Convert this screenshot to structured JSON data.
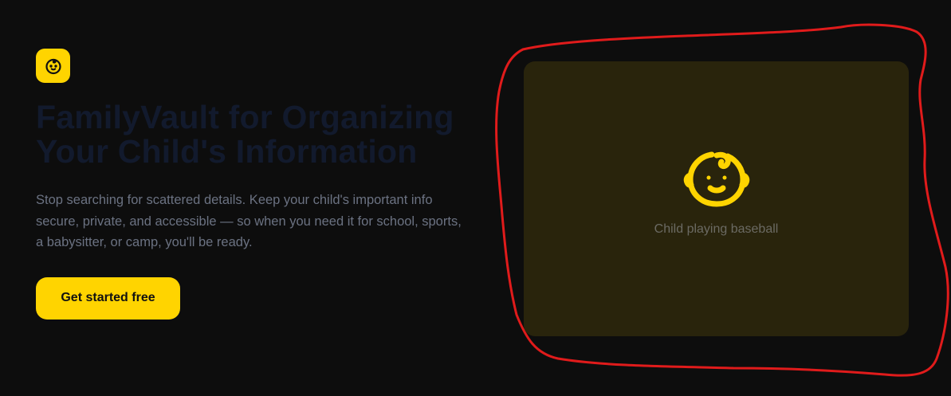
{
  "brand": {
    "icon": "baby-face-icon",
    "accent_color": "#ffd400"
  },
  "hero": {
    "title": "FamilyVault for Organizing Your Child's Information",
    "subtitle": "Stop searching for scattered details. Keep your child's important info secure, private, and accessible — so when you need it for school, sports, a babysitter, or camp, you'll be ready.",
    "cta_label": "Get started free"
  },
  "media": {
    "icon": "baby-face-icon",
    "caption": "Child playing baseball"
  },
  "annotation": {
    "color": "#e01b1b"
  }
}
